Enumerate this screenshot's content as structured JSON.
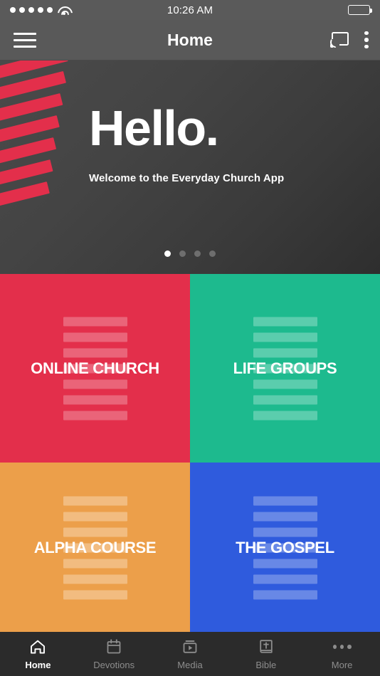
{
  "statusbar": {
    "signal_icon": "signal-dots",
    "wifi_icon": "wifi-icon",
    "time": "10:26 AM",
    "battery_icon": "battery-full-icon"
  },
  "navbar": {
    "menu_icon": "hamburger-menu-icon",
    "title": "Home",
    "cast_icon": "cast-icon",
    "overflow_icon": "overflow-menu-icon"
  },
  "hero": {
    "title": "Hello.",
    "subtitle": "Welcome to the Everyday Church App",
    "accent_color": "#E32F4B",
    "carousel": {
      "total": 4,
      "active_index": 0
    }
  },
  "tiles": [
    {
      "label": "ONLINE CHURCH",
      "color": "#E32F4B",
      "bar_color": "rgba(255,255,255,0.26)"
    },
    {
      "label": "LIFE GROUPS",
      "color": "#1DBA8E",
      "bar_color": "rgba(255,255,255,0.28)"
    },
    {
      "label": "ALPHA COURSE",
      "color": "#EC9F4A",
      "bar_color": "rgba(255,255,255,0.30)"
    },
    {
      "label": "THE GOSPEL",
      "color": "#2F5BDD",
      "bar_color": "rgba(255,255,255,0.28)"
    }
  ],
  "tabbar": {
    "items": [
      {
        "label": "Home",
        "icon": "home-icon",
        "active": true
      },
      {
        "label": "Devotions",
        "icon": "calendar-icon",
        "active": false
      },
      {
        "label": "Media",
        "icon": "video-play-icon",
        "active": false
      },
      {
        "label": "Bible",
        "icon": "bible-book-icon",
        "active": false
      },
      {
        "label": "More",
        "icon": "more-dots-icon",
        "active": false
      }
    ]
  }
}
